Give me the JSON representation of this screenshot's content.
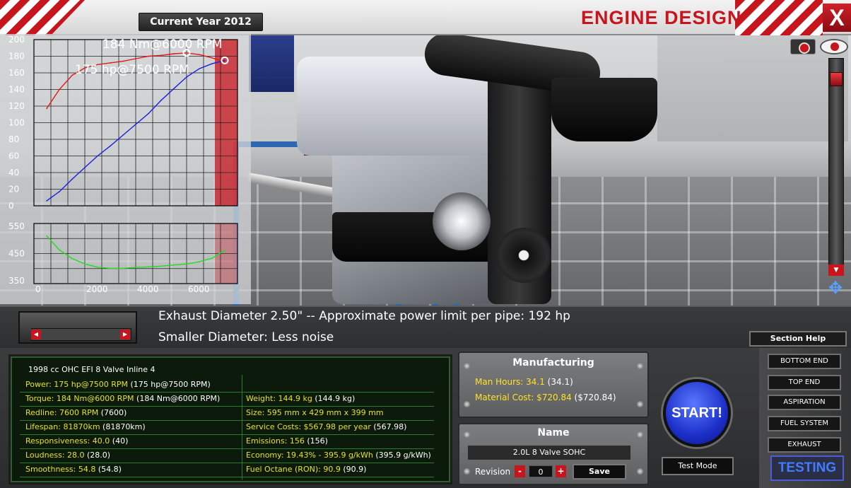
{
  "header": {
    "year_label": "Current Year 2012",
    "title": "ENGINE DESIGN",
    "close_label": "X"
  },
  "chart_data": {
    "type": "line",
    "torque_chart": {
      "ylim": [
        0,
        200
      ],
      "yticks": [
        "200",
        "180",
        "160",
        "140",
        "120",
        "100",
        "80",
        "60",
        "40",
        "20",
        "0"
      ],
      "torque_annotation": "184 Nm@6000 RPM",
      "power_annotation": "175 hp@7500 RPM",
      "series": [
        {
          "name": "torque",
          "color": "#e01818",
          "x": [
            500,
            1000,
            1500,
            2000,
            2500,
            3000,
            3500,
            4000,
            4500,
            5000,
            5500,
            6000,
            6500,
            7000,
            7500
          ],
          "y": [
            117,
            140,
            157,
            166,
            170,
            172,
            174,
            177,
            180,
            181,
            183,
            184,
            182,
            178,
            173
          ]
        },
        {
          "name": "power",
          "color": "#1820e0",
          "x": [
            500,
            1000,
            1500,
            2000,
            2500,
            3000,
            3500,
            4000,
            4500,
            5000,
            5500,
            6000,
            6500,
            7000,
            7500
          ],
          "y": [
            6,
            17,
            32,
            46,
            60,
            72,
            85,
            98,
            111,
            127,
            141,
            155,
            165,
            171,
            175
          ]
        }
      ]
    },
    "fuel_chart": {
      "ylim": [
        340,
        560
      ],
      "yticks": [
        "550",
        "450",
        "350"
      ],
      "xlim": [
        0,
        8000
      ],
      "xticks": [
        "0",
        "2000",
        "4000",
        "6000"
      ],
      "series": [
        {
          "name": "fuel",
          "color": "#22dd22",
          "x": [
            500,
            1000,
            1500,
            2000,
            2500,
            3000,
            3500,
            4000,
            4500,
            5000,
            5500,
            6000,
            6500,
            7000,
            7500
          ],
          "y": [
            515,
            463,
            432,
            412,
            400,
            396,
            396,
            399,
            401,
            404,
            408,
            412,
            420,
            433,
            462
          ]
        }
      ]
    }
  },
  "hint": {
    "line1": "Exhaust Diameter 2.50\" -- Approximate power limit per pipe: 192 hp",
    "line2": "Smaller Diameter: Less noise"
  },
  "section_help_label": "Section Help",
  "stats": {
    "engine_name": "1998 cc OHC EFI 8 Valve Inline 4",
    "left": [
      {
        "k": "Power: 175 hp@7500 RPM",
        "v": " (175 hp@7500 RPM)"
      },
      {
        "k": "Torque: 184 Nm@6000 RPM",
        "v": " (184 Nm@6000 RPM)"
      },
      {
        "k": "Redline: 7600 RPM",
        "v": " (7600)"
      },
      {
        "k": "Lifespan: 81870km",
        "v": " (81870km)"
      },
      {
        "k": "Responsiveness: 40.0",
        "v": " (40)"
      },
      {
        "k": "Loudness: 28.0",
        "v": " (28.0)"
      },
      {
        "k": "Smoothness: 54.8",
        "v": " (54.8)"
      }
    ],
    "right": [
      {
        "k": "Weight: 144.9 kg",
        "v": " (144.9 kg)"
      },
      {
        "k": "Size: 595 mm x 429 mm x 399 mm",
        "v": ""
      },
      {
        "k": "Service Costs: $567.98 per year",
        "v": " (567.98)"
      },
      {
        "k": "Emissions: 156",
        "v": " (156)"
      },
      {
        "k": "Economy: 19.43% - 395.9 g/kWh",
        "v": " (395.9 g/kWh)"
      },
      {
        "k": "Fuel Octane (RON): 90.9",
        "v": " (90.9)"
      }
    ]
  },
  "manufacturing": {
    "title": "Manufacturing",
    "man_hours_k": "Man Hours: 34.1",
    "man_hours_v": " (34.1)",
    "material_k": "Material Cost: $720.84",
    "material_v": " ($720.84)"
  },
  "name_panel": {
    "title": "Name",
    "engine_label": "2.0L 8 Valve SOHC",
    "revision_label": "Revision",
    "revision_value": "0",
    "minus": "-",
    "plus": "+",
    "save_label": "Save"
  },
  "start_label": "START!",
  "test_mode_label": "Test Mode",
  "nav": {
    "items": [
      "BOTTOM END",
      "TOP END",
      "ASPIRATION",
      "FUEL SYSTEM",
      "EXHAUST"
    ],
    "testing_label": "TESTING"
  }
}
